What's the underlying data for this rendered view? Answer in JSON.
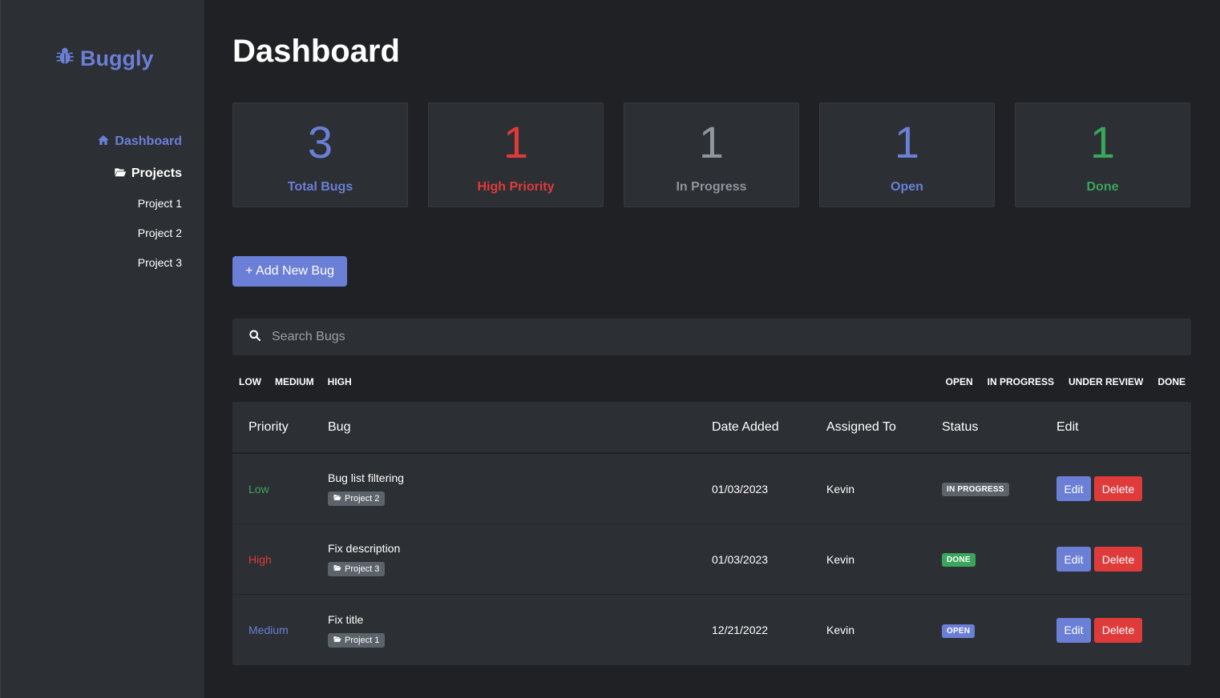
{
  "colors": {
    "accent": "#6b7fd7",
    "danger": "#e03b3b",
    "success": "#3aa55d",
    "muted": "#8e959c",
    "badge_gray": "#5c636a"
  },
  "sidebar": {
    "brand": "Buggly",
    "brand_icon": "bug-icon",
    "nav": [
      {
        "label": "Dashboard",
        "icon": "home-icon",
        "active": true
      },
      {
        "label": "Projects",
        "icon": "folder-open-icon",
        "active": false
      }
    ],
    "projects": [
      "Project 1",
      "Project 2",
      "Project 3"
    ]
  },
  "main": {
    "title": "Dashboard",
    "stats": [
      {
        "value": "3",
        "label": "Total Bugs",
        "color": "#6b7fd7"
      },
      {
        "value": "1",
        "label": "High Priority",
        "color": "#e03b3b"
      },
      {
        "value": "1",
        "label": "In Progress",
        "color": "#8e959c"
      },
      {
        "value": "1",
        "label": "Open",
        "color": "#6b7fd7"
      },
      {
        "value": "1",
        "label": "Done",
        "color": "#3aa55d"
      }
    ],
    "add_button": "+ Add New Bug",
    "search": {
      "placeholder": "Search Bugs",
      "value": ""
    },
    "priority_filters": [
      "LOW",
      "MEDIUM",
      "HIGH"
    ],
    "status_filters": [
      "OPEN",
      "IN PROGRESS",
      "UNDER REVIEW",
      "DONE"
    ],
    "table": {
      "headers": [
        "Priority",
        "Bug",
        "Date Added",
        "Assigned To",
        "Status",
        "Edit"
      ],
      "rows": [
        {
          "priority": "Low",
          "priority_color": "#3aa55d",
          "bug": "Bug list filtering",
          "project": "Project 2",
          "date": "01/03/2023",
          "assigned": "Kevin",
          "status": "IN PROGRESS",
          "status_color": "#5c636a",
          "edit": "Edit",
          "delete": "Delete"
        },
        {
          "priority": "High",
          "priority_color": "#e03b3b",
          "bug": "Fix description",
          "project": "Project 3",
          "date": "01/03/2023",
          "assigned": "Kevin",
          "status": "DONE",
          "status_color": "#3aa55d",
          "edit": "Edit",
          "delete": "Delete"
        },
        {
          "priority": "Medium",
          "priority_color": "#6b7fd7",
          "bug": "Fix title",
          "project": "Project 1",
          "date": "12/21/2022",
          "assigned": "Kevin",
          "status": "OPEN",
          "status_color": "#6b7fd7",
          "edit": "Edit",
          "delete": "Delete"
        }
      ]
    }
  }
}
